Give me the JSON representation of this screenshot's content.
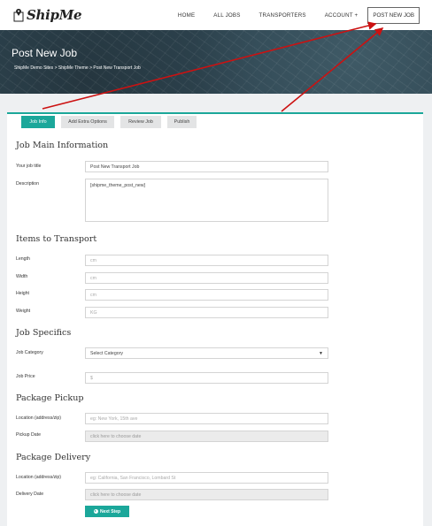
{
  "header": {
    "logo_text": "ShipMe",
    "nav": [
      {
        "label": "HOME"
      },
      {
        "label": "ALL JOBS"
      },
      {
        "label": "TRANSPORTERS"
      },
      {
        "label": "ACCOUNT +"
      }
    ],
    "post_job_label": "POST NEW JOB"
  },
  "banner": {
    "title": "Post New Job",
    "breadcrumb": "ShipMe Demo Sites > ShipMe Theme > Post New Transport Job"
  },
  "tabs": [
    {
      "label": "Job Info",
      "active": true
    },
    {
      "label": "Add Extra Options",
      "active": false
    },
    {
      "label": "Review Job",
      "active": false
    },
    {
      "label": "Publish",
      "active": false
    }
  ],
  "sections": {
    "main": {
      "title": "Job Main Information",
      "job_title_label": "Your job title",
      "job_title_value": "Post New Transport Job",
      "description_label": "Description",
      "description_value": "[shipme_theme_post_new]"
    },
    "items": {
      "title": "Items to Transport",
      "length_label": "Length",
      "length_placeholder": "cm",
      "width_label": "Width",
      "width_placeholder": "cm",
      "height_label": "Height",
      "height_placeholder": "cm",
      "weight_label": "Weight",
      "weight_placeholder": "KG"
    },
    "specifics": {
      "title": "Job Specifics",
      "category_label": "Job Category",
      "category_value": "Select Category",
      "price_label": "Job Price",
      "price_placeholder": "$"
    },
    "pickup": {
      "title": "Package Pickup",
      "location_label": "Location (address/zip)",
      "location_placeholder": "eg: New York, 15th ave",
      "date_label": "Pickup Date",
      "date_placeholder": "click here to choose date"
    },
    "delivery": {
      "title": "Package Delivery",
      "location_label": "Location (address/zip)",
      "location_placeholder": "eg: California, San Francisco, Lombard St",
      "date_label": "Delivery Date",
      "date_placeholder": "click here to choose date"
    }
  },
  "next_button_label": "Next Step",
  "colors": {
    "accent": "#1ba79a",
    "annotation": "#cc1111"
  }
}
